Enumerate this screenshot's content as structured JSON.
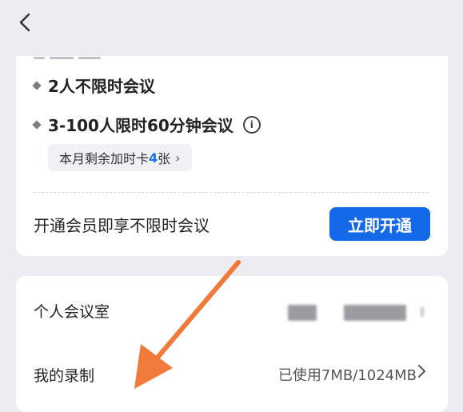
{
  "header": {
    "back_icon": "chevron-left-icon"
  },
  "plan": {
    "features": [
      {
        "text": "2人不限时会议"
      },
      {
        "text": "3-100人限时60分钟会议",
        "info_icon": "info-icon"
      }
    ],
    "chip": {
      "prefix": "本月剩余加时卡",
      "count": "4",
      "suffix": "张",
      "chevron": "›"
    },
    "vip_text": "开通会员即享不限时会议",
    "cta_label": "立即开通"
  },
  "settings": {
    "personal_room_label": "个人会议室",
    "recording_label": "我的录制",
    "recording_usage": "已使用7MB/1024MB"
  },
  "colors": {
    "accent": "#1469e8",
    "chip_count": "#1a73e8",
    "annotation_arrow": "#f07a3a",
    "background": "#ececf1"
  }
}
